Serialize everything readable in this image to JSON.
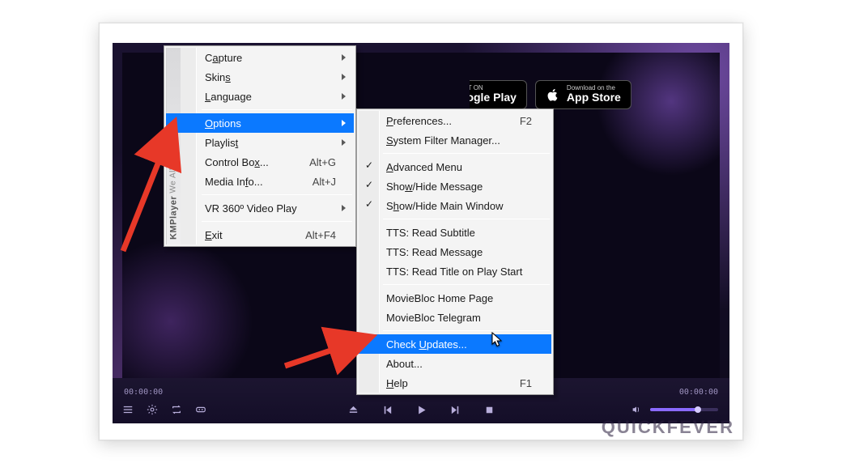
{
  "brand": {
    "name": "KMPlayer",
    "tagline": "We All Enjoy !"
  },
  "badges": {
    "google_small": "GET IT ON",
    "google_big": "Google Play",
    "apple_small": "Download on the",
    "apple_big": "App Store"
  },
  "watermark": "QUICKFEVER",
  "player": {
    "time_left": "00:00:00",
    "time_right": "00:00:00",
    "volume_pct": 70
  },
  "menu1": {
    "items": [
      {
        "label_html": "C<u>a</u>pture",
        "sub": true
      },
      {
        "label_html": "Skin<u>s</u>",
        "sub": true
      },
      {
        "label_html": "<u>L</u>anguage",
        "sub": true
      },
      {
        "sep": true
      },
      {
        "label_html": "<u>O</u>ptions",
        "sub": true,
        "sel": true
      },
      {
        "label_html": "Playlis<u>t</u>",
        "sub": true
      },
      {
        "label_html": "Control Bo<u>x</u>...",
        "sc": "Alt+G"
      },
      {
        "label_html": "Media In<u>f</u>o...",
        "sc": "Alt+J"
      },
      {
        "sep": true
      },
      {
        "label_html": "VR 360º Video Play",
        "sub": true
      },
      {
        "sep": true
      },
      {
        "label_html": "<u>E</u>xit",
        "sc": "Alt+F4"
      }
    ]
  },
  "menu2": {
    "items": [
      {
        "label_html": "<u>P</u>references...",
        "sc": "F2"
      },
      {
        "label_html": "<u>S</u>ystem Filter Manager..."
      },
      {
        "sep": true
      },
      {
        "label_html": "<u>A</u>dvanced Menu",
        "chk": true
      },
      {
        "label_html": "Sho<u>w</u>/Hide Message",
        "chk": true
      },
      {
        "label_html": "S<u>h</u>ow/Hide Main Window",
        "chk": true
      },
      {
        "sep": true
      },
      {
        "label_html": "TTS: Read Subtitle"
      },
      {
        "label_html": "TTS: Read Message"
      },
      {
        "label_html": "TTS: Read Title on Play Start"
      },
      {
        "sep": true
      },
      {
        "label_html": "MovieBloc Home Page"
      },
      {
        "label_html": "MovieBloc Telegram"
      },
      {
        "sep": true
      },
      {
        "label_html": "Check <u>U</u>pdates...",
        "sel": true
      },
      {
        "label_html": "About..."
      },
      {
        "label_html": "<u>H</u>elp",
        "sc": "F1"
      }
    ]
  }
}
